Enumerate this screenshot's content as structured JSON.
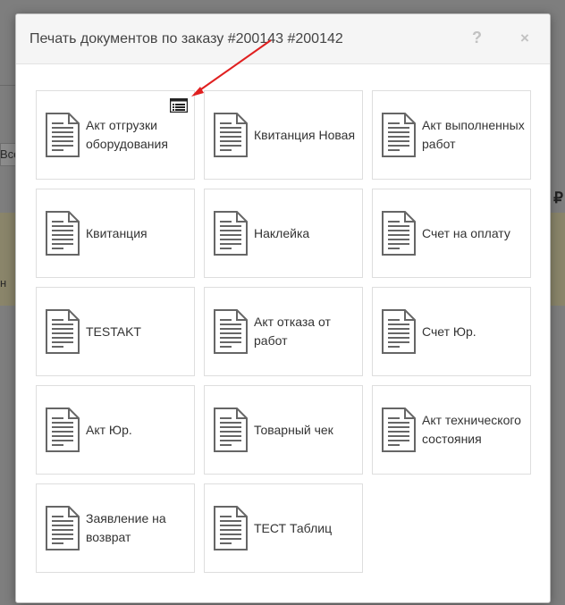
{
  "background": {
    "fragment_left": "Все",
    "fragment_row": "н",
    "currency": "₽"
  },
  "dialog": {
    "title": "Печать документов по заказу #200143 #200142",
    "help_label": "?",
    "close_label": "×"
  },
  "documents": [
    {
      "label": "Акт отгрузки оборудования"
    },
    {
      "label": "Квитанция Новая"
    },
    {
      "label": "Акт выполненных работ"
    },
    {
      "label": "Квитанция"
    },
    {
      "label": "Наклейка"
    },
    {
      "label": "Счет на оплату"
    },
    {
      "label": "TESTAKT"
    },
    {
      "label": "Акт отказа от работ"
    },
    {
      "label": "Счет Юр."
    },
    {
      "label": "Акт Юр."
    },
    {
      "label": "Товарный чек"
    },
    {
      "label": "Акт технического состояния"
    },
    {
      "label": "Заявление на возврат"
    },
    {
      "label": "ТЕСТ Таблиц"
    }
  ],
  "icons": {
    "document": "document-icon",
    "table_view": "table-view-icon",
    "annotation": "red-arrow"
  },
  "colors": {
    "arrow": "#e02020",
    "tile_border": "#dedede",
    "header_bg": "#f5f5f5"
  }
}
